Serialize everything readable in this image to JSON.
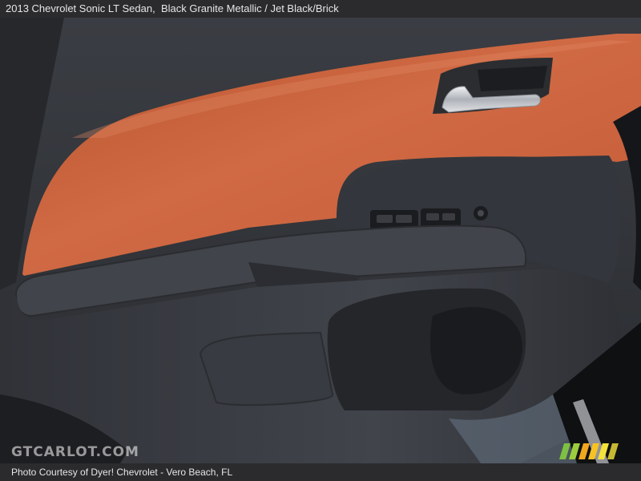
{
  "caption": {
    "title": "2013 Chevrolet Sonic LT Sedan,",
    "color_info": "Black Granite Metallic / Jet Black/Brick"
  },
  "watermark": {
    "text": "GTCARLOT.COM"
  },
  "credit": {
    "text": "Photo Courtesy of Dyer! Chevrolet - Vero Beach, FL"
  },
  "colors": {
    "brick_panel": "#c9633f",
    "door_dark": "#2a2c31",
    "door_mid": "#3c3f45",
    "chrome": "#d8dadd",
    "bar_bg": "#2b2b2e"
  }
}
